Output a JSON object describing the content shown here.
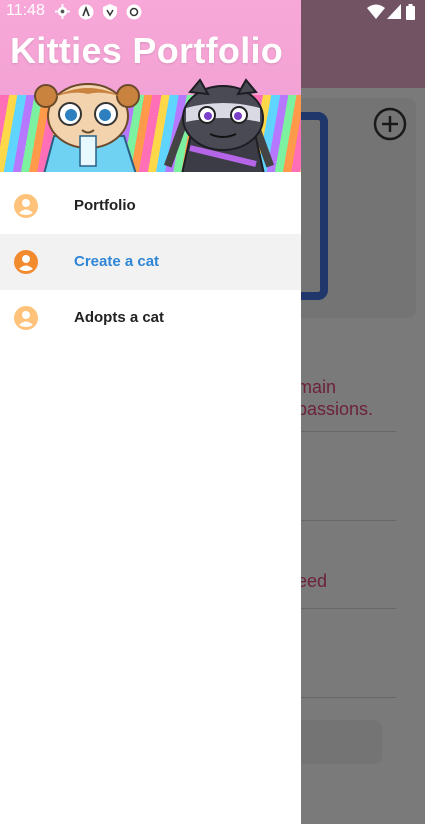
{
  "status_bar": {
    "time": "11:48",
    "left_icons": [
      "gear-icon",
      "a-icon",
      "shield-icon",
      "at-icon"
    ],
    "right_icons": [
      "wifi-icon",
      "signal-icon",
      "battery-icon"
    ]
  },
  "drawer": {
    "title": "Kitties Portfolio",
    "menu": [
      {
        "label": "Portfolio",
        "icon": "account-icon",
        "active": false
      },
      {
        "label": "Create a cat",
        "icon": "account-icon",
        "active": true
      },
      {
        "label": "Adopts a cat",
        "icon": "account-icon",
        "active": false
      }
    ],
    "icon_color": "#ffb56b",
    "icon_color_active": "#f28a2e",
    "active_color": "#2f86d6"
  },
  "background": {
    "text_1": "main",
    "text_2": "passions.",
    "text_3": "eed",
    "accent": "#d9437a"
  }
}
